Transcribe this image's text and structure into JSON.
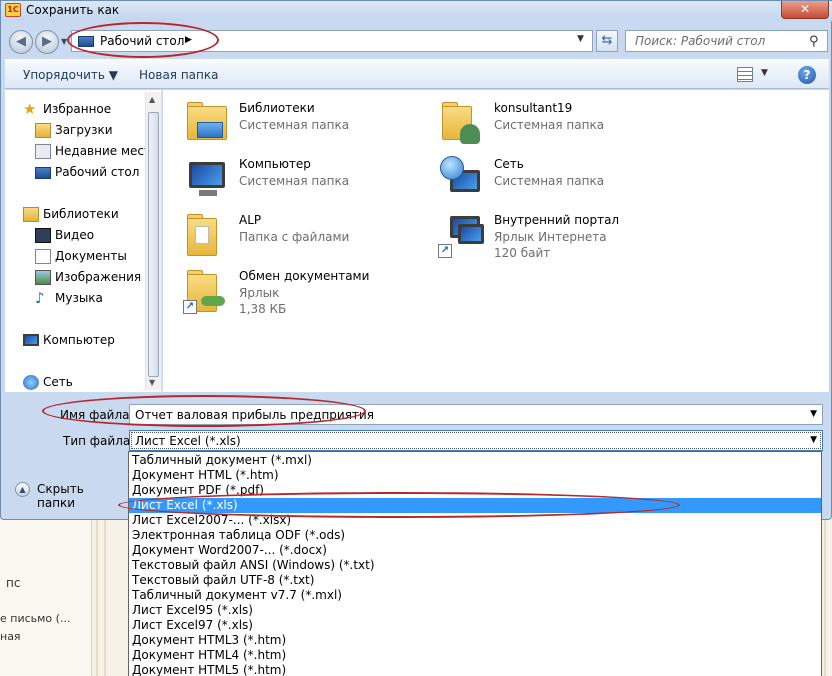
{
  "window": {
    "title": "Сохранить как",
    "close": "✕"
  },
  "address": {
    "location": "Рабочий стол",
    "search_placeholder": "Поиск: Рабочий стол"
  },
  "toolbar": {
    "organize": "Упорядочить ▼",
    "new_folder": "Новая папка",
    "help": "?"
  },
  "navigation": {
    "favorites": "Избранное",
    "downloads": "Загрузки",
    "recent": "Недавние места",
    "desktop": "Рабочий стол",
    "libraries": "Библиотеки",
    "video": "Видео",
    "documents": "Документы",
    "images": "Изображения",
    "music": "Музыка",
    "computer": "Компьютер",
    "network": "Сеть"
  },
  "files": [
    {
      "name": "Библиотеки",
      "type": "Системная папка",
      "info": "",
      "icon": "libraries-folder-icon"
    },
    {
      "name": "konsultant19",
      "type": "Системная папка",
      "info": "",
      "icon": "user-folder-icon"
    },
    {
      "name": "Компьютер",
      "type": "Системная папка",
      "info": "",
      "icon": "computer-icon"
    },
    {
      "name": "Сеть",
      "type": "Системная папка",
      "info": "",
      "icon": "network-icon"
    },
    {
      "name": "ALP",
      "type": "Папка с файлами",
      "info": "",
      "icon": "folder-icon"
    },
    {
      "name": "Внутренний портал",
      "type": "Ярлык Интернета",
      "info": "120 байт",
      "icon": "internet-shortcut-icon"
    },
    {
      "name": "Обмен документами",
      "type": "Ярлык",
      "info": "1,38 КБ",
      "icon": "folder-shortcut-icon"
    }
  ],
  "form": {
    "filename_label": "Имя файла:",
    "filename_value": "Отчет валовая прибыль предприятия",
    "filetype_label": "Тип файла:",
    "filetype_value": "Лист Excel (*.xls)"
  },
  "hide_folders": "Скрыть папки",
  "filetype_options": [
    "Табличный документ (*.mxl)",
    "Документ HTML (*.htm)",
    "Документ PDF (*.pdf)",
    "Лист Excel (*.xls)",
    "Лист Excel2007-... (*.xlsx)",
    "Электронная таблица ODF (*.ods)",
    "Документ Word2007-... (*.docx)",
    "Текстовый файл ANSI (Windows) (*.txt)",
    "Текстовый файл UTF-8 (*.txt)",
    "Табличный документ v7.7 (*.mxl)",
    "Лист Excel95 (*.xls)",
    "Лист Excel97 (*.xls)",
    "Документ HTML3 (*.htm)",
    "Документ HTML4 (*.htm)",
    "Документ HTML5 (*.htm)"
  ],
  "selected_option_index": 3,
  "background": {
    "line1": "пс",
    "line2": "е письмо (...",
    "line3": "ная"
  },
  "colors": {
    "selection": "#3399ff",
    "annotation": "#b4282e"
  }
}
